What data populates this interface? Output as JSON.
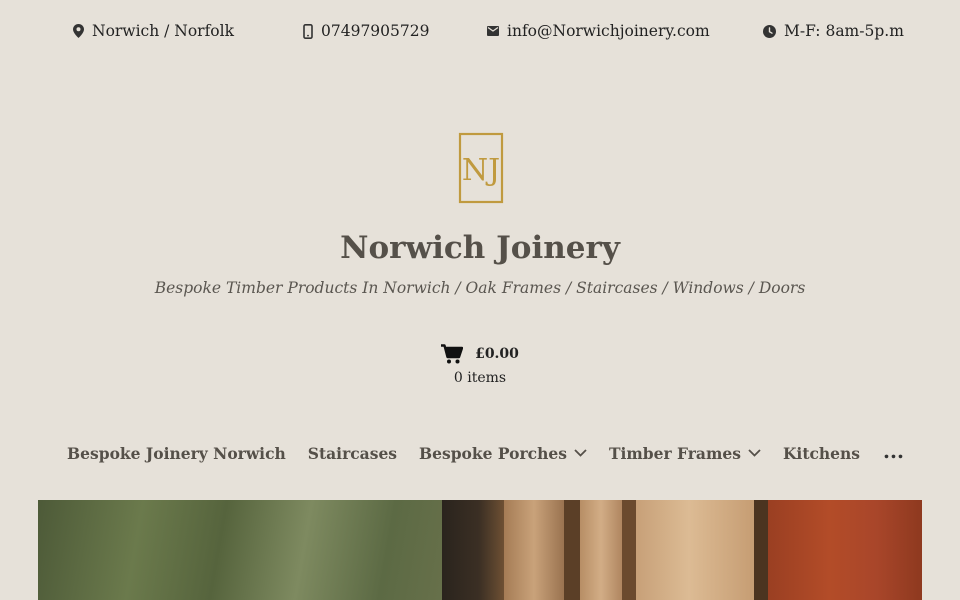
{
  "topbar": {
    "location": "Norwich / Norfolk",
    "phone": "07497905729",
    "email": "info@Norwichjoinery.com",
    "hours": "M-F: 8am-5p.m"
  },
  "site": {
    "title": "Norwich Joinery",
    "tagline": "Bespoke Timber Products In Norwich / Oak Frames / Staircases / Windows / Doors",
    "logo_letters": "NJ",
    "logo_color": "#c09a3f"
  },
  "cart": {
    "total": "£0.00",
    "count": "0 items"
  },
  "nav": {
    "items": [
      {
        "label": "Bespoke Joinery Norwich",
        "dropdown": false
      },
      {
        "label": "Staircases",
        "dropdown": false
      },
      {
        "label": "Bespoke Porches",
        "dropdown": true
      },
      {
        "label": "Timber Frames",
        "dropdown": true
      },
      {
        "label": "Kitchens",
        "dropdown": false
      }
    ],
    "more": "..."
  },
  "colors": {
    "background": "#e6e1d9",
    "title": "#555049",
    "gold": "#c09a3f"
  },
  "icons": [
    "map-pin-icon",
    "mobile-phone-icon",
    "envelope-icon",
    "clock-icon",
    "cart-icon",
    "chevron-down-icon"
  ]
}
